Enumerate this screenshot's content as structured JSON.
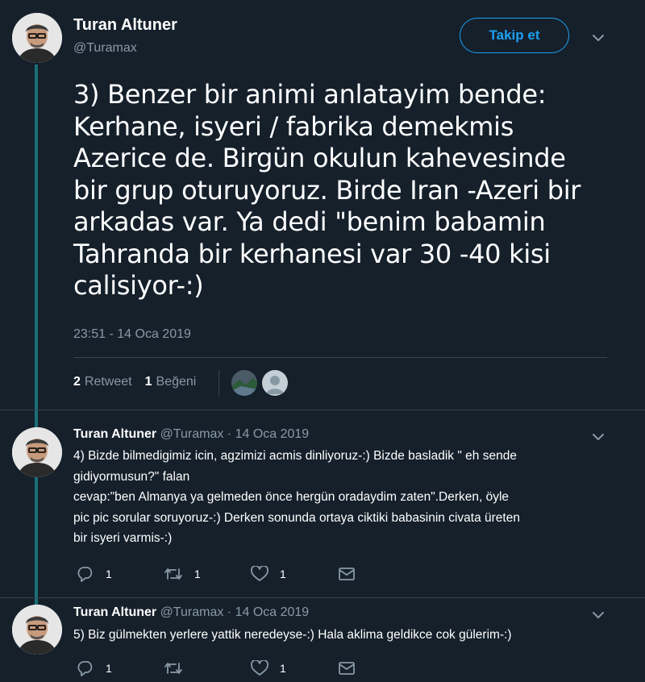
{
  "author": {
    "name": "Turan Altuner",
    "handle": "@Turamax"
  },
  "follow_label": "Takip et",
  "tweet": {
    "lines": [
      "3) Benzer bir animi anlatayim bende:",
      "Kerhane, isyeri / fabrika demekmis",
      "Azerice de. Birgün okulun kahevesinde",
      "bir grup oturuyoruz. Birde Iran -Azeri bir",
      "arkadas var. Ya dedi \"benim babamin",
      "Tahranda bir kerhanesi var 30 -40 kisi",
      "calisiyor-:)"
    ],
    "timestamp": "23:51 - 14 Oca 2019",
    "retweet_count": "2",
    "retweet_label": "Retweet",
    "like_count": "1",
    "like_label": "Beğeni"
  },
  "replies": [
    {
      "name": "Turan Altuner",
      "handle": "@Turamax",
      "sep": "·",
      "date": "14 Oca 2019",
      "lines": [
        "4) Bizde bilmedigimiz icin, agzimizi acmis dinliyoruz-:) Bizde basladik \" eh sende",
        "gidiyormusun?\" falan",
        "cevap:\"ben Almanya ya gelmeden önce hergün oradaydim zaten\".Derken, öyle",
        "pic pic sorular soruyoruz-:) Derken sonunda ortaya ciktiki babasinin civata üreten",
        "bir isyeri varmis-:)"
      ],
      "reply_count": "1",
      "retweet_count": "1",
      "like_count": "1"
    },
    {
      "name": "Turan Altuner",
      "handle": "@Turamax",
      "sep": "·",
      "date": "14 Oca 2019",
      "lines": [
        "5) Biz gülmekten yerlere yattik neredeyse-:) Hala aklima geldikce cok gülerim-:)"
      ],
      "reply_count": "1",
      "retweet_count": "",
      "like_count": "1"
    }
  ],
  "icons": {
    "reply": "reply-icon",
    "retweet": "retweet-icon",
    "like": "heart-icon",
    "dm": "envelope-icon",
    "more": "chevron-down-icon"
  },
  "colors": {
    "background": "#15202b",
    "accent": "#1da1f2",
    "thread_line": "#1b6f77",
    "muted": "#8899a6"
  }
}
